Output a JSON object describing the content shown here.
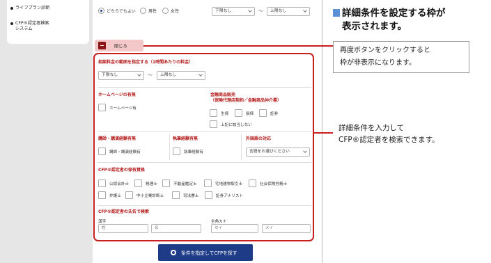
{
  "sidebar": {
    "items": [
      {
        "label": "ライフプラン診断"
      },
      {
        "label": "CFP®認定者検索",
        "label2": "システム"
      }
    ]
  },
  "gender": {
    "options": [
      "どちらでもよい",
      "男性",
      "女性"
    ],
    "selected": "どちらでもよい"
  },
  "age_range": {
    "from": "下限なし",
    "tilde": "〜",
    "to": "上限なし"
  },
  "close_button": {
    "label": "閉じる"
  },
  "fee": {
    "heading": "相談料金の範囲を指定する（1時間あたりの料金）",
    "from": "下限なし",
    "tilde": "〜",
    "to": "上限なし"
  },
  "homepage": {
    "heading": "ホームページの有無",
    "checkbox": "ホームページ有"
  },
  "financial": {
    "heading": "金融商品販売",
    "heading2": "（保険代理店契約／金融商品仲介業）",
    "options": [
      "生保",
      "損保",
      "証券"
    ],
    "extra": "上記に該当しない"
  },
  "lecture": {
    "heading": "講師・講演経験有無",
    "checkbox": "講師・講演経験有"
  },
  "writing": {
    "heading": "執筆経験有無",
    "checkbox": "執筆経験有"
  },
  "language": {
    "heading": "外国語の対応",
    "select": "言語をお選びください"
  },
  "qualifications": {
    "heading": "CFP®認定者の保有資格",
    "row1": [
      "公認会計士",
      "税理士",
      "不動産鑑定士",
      "宅地建物取引士",
      "社会保険労務士"
    ],
    "row2": [
      "弁護士",
      "中小企業診断士",
      "司法書士",
      "証券アナリスト"
    ]
  },
  "name_search": {
    "heading": "CFP®認定者の氏名で検索",
    "kanji_label": "漢字",
    "kana_label": "全角カナ",
    "kanji_sei": "姓",
    "kanji_mei": "名",
    "kana_sei": "セイ",
    "kana_mei": "メイ"
  },
  "search_button": {
    "label": "条件を指定してCFPを探す"
  },
  "annotations": {
    "heading_line1": "詳細条件を設定する枠が",
    "heading_line2": "表示されます。",
    "note_line1": "再度ボタンをクリックすると",
    "note_line2": "枠が非表示になります。",
    "desc_line1": "詳細条件を入力して",
    "desc_line2": "CFP®認定者を検索できます。"
  },
  "colors": {
    "accent_red": "#c81e1e",
    "button_navy": "#1d3b86",
    "heading_marker": "#5b8fd6"
  }
}
